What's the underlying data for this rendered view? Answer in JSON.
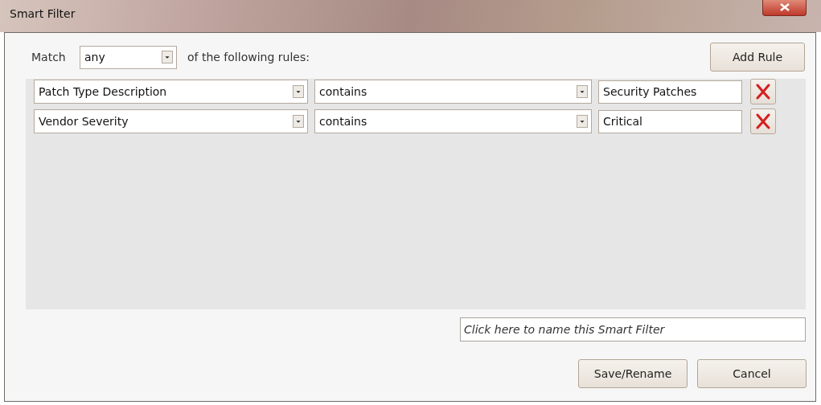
{
  "window": {
    "title": "Smart Filter"
  },
  "match": {
    "label": "Match",
    "value": "any",
    "suffix": "of the following rules:"
  },
  "add_rule_button": "Add Rule",
  "rules": [
    {
      "field": "Patch Type Description",
      "operator": "contains",
      "value": "Security Patches"
    },
    {
      "field": "Vendor Severity",
      "operator": "contains",
      "value": "Critical"
    }
  ],
  "name_field": {
    "placeholder": "Click here to name this Smart Filter"
  },
  "buttons": [
    "Save/Rename",
    "Cancel"
  ]
}
